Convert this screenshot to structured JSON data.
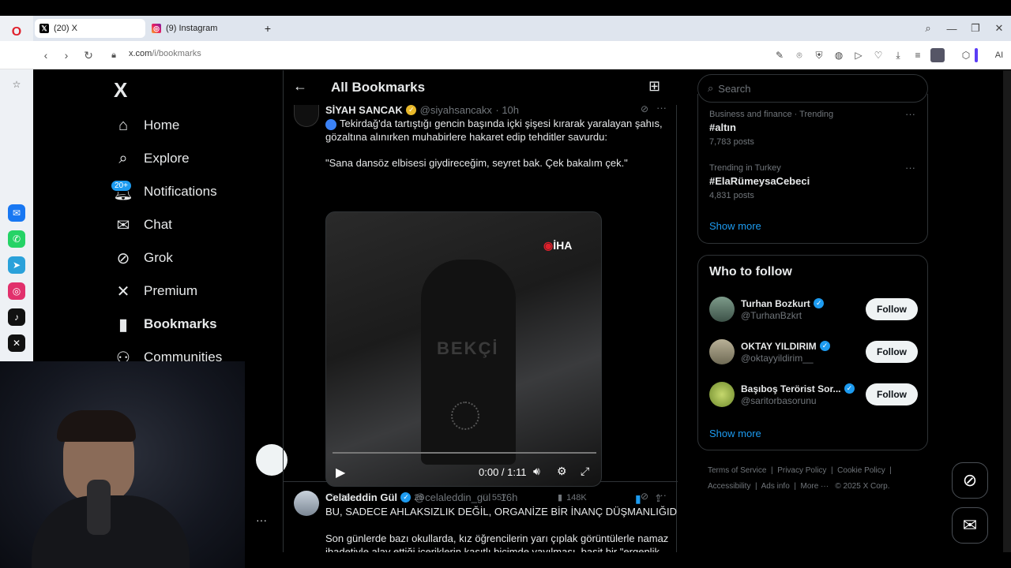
{
  "browser": {
    "tabs": [
      {
        "label": "(20) X",
        "favicon": "x-favicon"
      },
      {
        "label": "(9) Instagram",
        "favicon": "instagram-favicon"
      }
    ],
    "url_host": "x.com",
    "url_path": "/i/bookmarks",
    "ai_label": "AI"
  },
  "sidebar": {
    "logo": "X",
    "items": [
      {
        "label": "Home",
        "icon": "home-icon"
      },
      {
        "label": "Explore",
        "icon": "search-icon"
      },
      {
        "label": "Notifications",
        "icon": "bell-icon",
        "badge": "20+"
      },
      {
        "label": "Chat",
        "icon": "mail-icon"
      },
      {
        "label": "Grok",
        "icon": "grok-icon"
      },
      {
        "label": "Premium",
        "icon": "x-icon"
      },
      {
        "label": "Bookmarks",
        "icon": "bookmark-icon"
      },
      {
        "label": "Communities",
        "icon": "people-icon"
      }
    ],
    "more": "···"
  },
  "header": {
    "title": "All Bookmarks"
  },
  "tweet1": {
    "name": "SİYAH SANCAK",
    "handle": "@siyahsancakx",
    "time": "· 10h",
    "line1": "Tekirdağ'da tartıştığı gencin başında içki şişesi kırarak yaralayan şahıs,",
    "line2": "gözaltına alınırken muhabirlere hakaret edip tehditler savurdu:",
    "quote": "\"Sana dansöz elbisesi giydireceğim, seyret bak. Çek bakalım çek.\"",
    "video": {
      "watermark": "İHA",
      "jacket_text": "BEKÇİ",
      "time": "0:00 / 1:11"
    },
    "stats": {
      "replies": "18",
      "reposts": "26",
      "likes": "557",
      "views": "148K"
    }
  },
  "tweet2": {
    "name": "Celaleddin Gül",
    "handle": "@celaleddin_gul",
    "time": "· 16h",
    "line1": "BU, SADECE AHLAKSIZLIK DEĞİL, ORGANİZE BİR İNANÇ DÜŞMANLIĞIDIR!",
    "line2": "Son günlerde bazı okullarda, kız öğrencilerin yarı çıplak görüntülerle namaz",
    "line3": "ibadetiyle alay ettiği içeriklerin kasıtlı biçimde yayılması, basit bir \"ergenlik"
  },
  "right": {
    "search_placeholder": "Search",
    "trends": [
      {
        "meta": "Business and finance · Trending",
        "name": "#altın",
        "posts": "7,783 posts"
      },
      {
        "meta": "Trending in Turkey",
        "name": "#ElaRümeysaCebeci",
        "posts": "4,831 posts"
      }
    ],
    "show_more": "Show more",
    "who_to_follow": "Who to follow",
    "follow_label": "Follow",
    "suggestions": [
      {
        "name": "Turhan Bozkurt",
        "handle": "@TurhanBzkrt"
      },
      {
        "name": "OKTAY YILDIRIM",
        "handle": "@oktayyildirim__"
      },
      {
        "name": "Başıboş Terörist Sor...",
        "handle": "@saritorbasorunu"
      }
    ],
    "footer": {
      "terms": "Terms of Service",
      "privacy": "Privacy Policy",
      "cookie": "Cookie Policy",
      "accessibility": "Accessibility",
      "ads": "Ads info",
      "more": "More ···",
      "copyright": "© 2025 X Corp."
    }
  },
  "colors": {
    "accent": "#1d9bf0",
    "bg": "#000000",
    "border": "#2f3336",
    "muted": "#71767b"
  }
}
